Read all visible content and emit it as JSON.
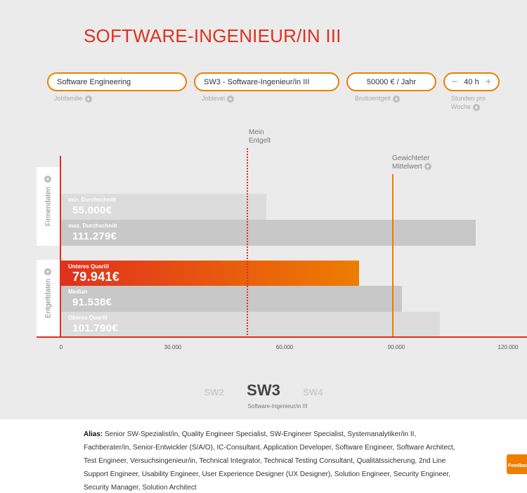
{
  "page_title": "SOFTWARE-INGENIEUR/IN III",
  "filters": {
    "jobfamilie": {
      "value": "Software Engineering",
      "caption": "Jobfamilie"
    },
    "joblevel": {
      "value": "SW3 - Software-Ingenieur/in III",
      "caption": "Joblevel"
    },
    "brutto": {
      "value": "50000 € / Jahr",
      "caption": "Bruttoentgelt"
    },
    "stunden": {
      "minus": "−",
      "value": "40 h",
      "plus": "+",
      "caption_line1": "Stunden pro",
      "caption_line2": "Woche"
    }
  },
  "info_glyph": "+",
  "chart_data": {
    "type": "bar",
    "orientation": "horizontal",
    "groups": [
      {
        "name": "Firmendaten",
        "bars": [
          {
            "label": "min. Durchschnitt",
            "value_text": "55.000€",
            "value": 55000
          },
          {
            "label": "max. Durchschnitt",
            "value_text": "111.279€",
            "value": 111279
          }
        ]
      },
      {
        "name": "Entgeltdaten",
        "bars": [
          {
            "label": "Unteres Quartil",
            "value_text": "79.941€",
            "value": 79941,
            "highlight": true
          },
          {
            "label": "Median",
            "value_text": "91.538€",
            "value": 91538
          },
          {
            "label": "Oberes Quartil",
            "value_text": "101.790€",
            "value": 101790
          }
        ]
      }
    ],
    "xlim": [
      0,
      120000
    ],
    "ticks": [
      "0",
      "30.000",
      "60.000",
      "90.000",
      "120.000"
    ],
    "markers": [
      {
        "label_line1": "Mein",
        "label_line2": "Entgelt",
        "value": 50000,
        "style": "dotted",
        "color": "#e0301e"
      },
      {
        "label_line1": "Gewichteter",
        "label_line2": "Mittelwert",
        "value": 90000,
        "style": "solid",
        "color": "#ee7d00"
      }
    ]
  },
  "levels": {
    "prev": "SW2",
    "current": "SW3",
    "next": "SW4",
    "current_name": "Software-Ingenieur/in III"
  },
  "alias": {
    "label": "Alias:",
    "text": " Senior SW-Spezialist/in, Quality Engineer Specialist, SW-Engineer Specialist, Systemanalytiker/in II, Fachberater/in, Senior-Entwickler (S/A/O), IC-Consultant, Application Developer, Software Engineer, Software Architect, Test Engineer, Versuchsingenieur/in, Technical Integrator, Technical Testing Consultant, Qualitätssicherung, 2nd Line Support Engineer, Usability Engineer, User Experience Designer (UX Designer), Solution Engineer, Security Engineer, Security Manager, Solution Architect"
  },
  "feedback_label": "Feedback",
  "colors": {
    "accent_red": "#e0301e",
    "accent_orange": "#ee7d00",
    "bar_light": "#dcdcdc",
    "bar_dark": "#c8c8c8"
  }
}
